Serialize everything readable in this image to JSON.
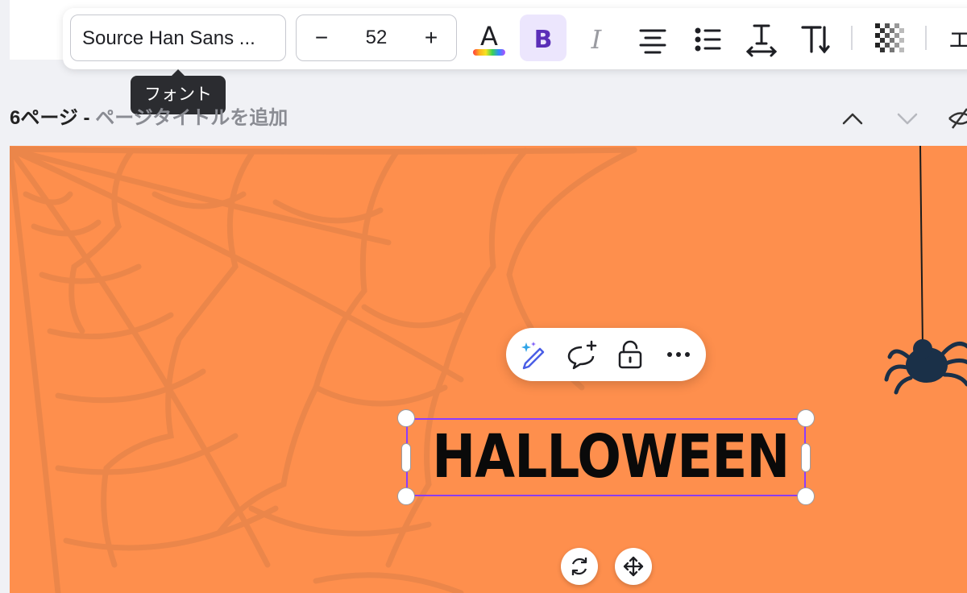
{
  "toolbar": {
    "font_name": "Source Han Sans ...",
    "font_size": "52",
    "decrease_label": "−",
    "increase_label": "+",
    "text_color_glyph": "A",
    "bold_glyph": "B",
    "italic_glyph": "I",
    "cut_off_glyph": "エ",
    "icons": [
      "text-color-icon",
      "bold-icon",
      "italic-icon",
      "align-center-icon",
      "list-icon",
      "letter-spacing-icon",
      "text-size-icon",
      "transparency-icon"
    ]
  },
  "tooltip": {
    "text": "フォント"
  },
  "page": {
    "number_label": "6ページ",
    "separator": " - ",
    "title_placeholder": "ページタイトルを追加"
  },
  "canvas": {
    "background": "#fe8f4d",
    "headline": "HALLOWEEN"
  },
  "floating_menu": {
    "icons": [
      "magic-edit-icon",
      "comment-icon",
      "lock-icon",
      "more-icon"
    ]
  },
  "colors": {
    "accent": "#8b3dff",
    "bold_active_bg": "#ece6fd",
    "tooltip_bg": "#2b2c30",
    "spider": "#1a3048"
  }
}
